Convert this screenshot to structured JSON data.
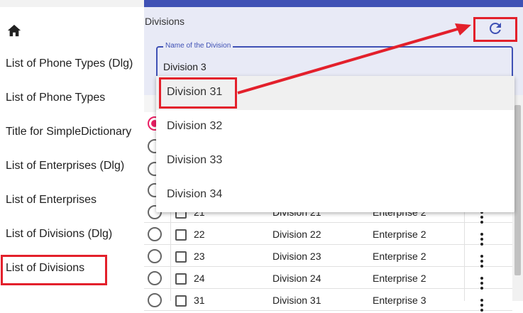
{
  "sidebar": {
    "items": [
      {
        "label": "List of Phone Types (Dlg)"
      },
      {
        "label": "List of Phone Types"
      },
      {
        "label": "Title for SimpleDictionary"
      },
      {
        "label": "List of Enterprises (Dlg)"
      },
      {
        "label": "List of Enterprises"
      },
      {
        "label": "List of Divisions (Dlg)"
      },
      {
        "label": "List of Divisions"
      }
    ]
  },
  "panel": {
    "title": "Divisions",
    "field": {
      "label": "Name of the Division",
      "value": "Division 3"
    }
  },
  "dropdown": {
    "options": [
      "Division 31",
      "Division 32",
      "Division 33",
      "Division 34"
    ]
  },
  "table": {
    "rows": [
      {
        "id": "21",
        "name": "Division 21",
        "enterprise": "Enterprise 2"
      },
      {
        "id": "22",
        "name": "Division 22",
        "enterprise": "Enterprise 2"
      },
      {
        "id": "23",
        "name": "Division 23",
        "enterprise": "Enterprise 2"
      },
      {
        "id": "24",
        "name": "Division 24",
        "enterprise": "Enterprise 2"
      },
      {
        "id": "31",
        "name": "Division 31",
        "enterprise": "Enterprise 3"
      }
    ]
  },
  "colors": {
    "accent": "#3f51b5",
    "highlight": "#e3202b",
    "radio_checked": "#e91e63"
  },
  "icons": {
    "home": "home-icon",
    "refresh": "refresh-icon",
    "more": "more-vert-icon"
  }
}
